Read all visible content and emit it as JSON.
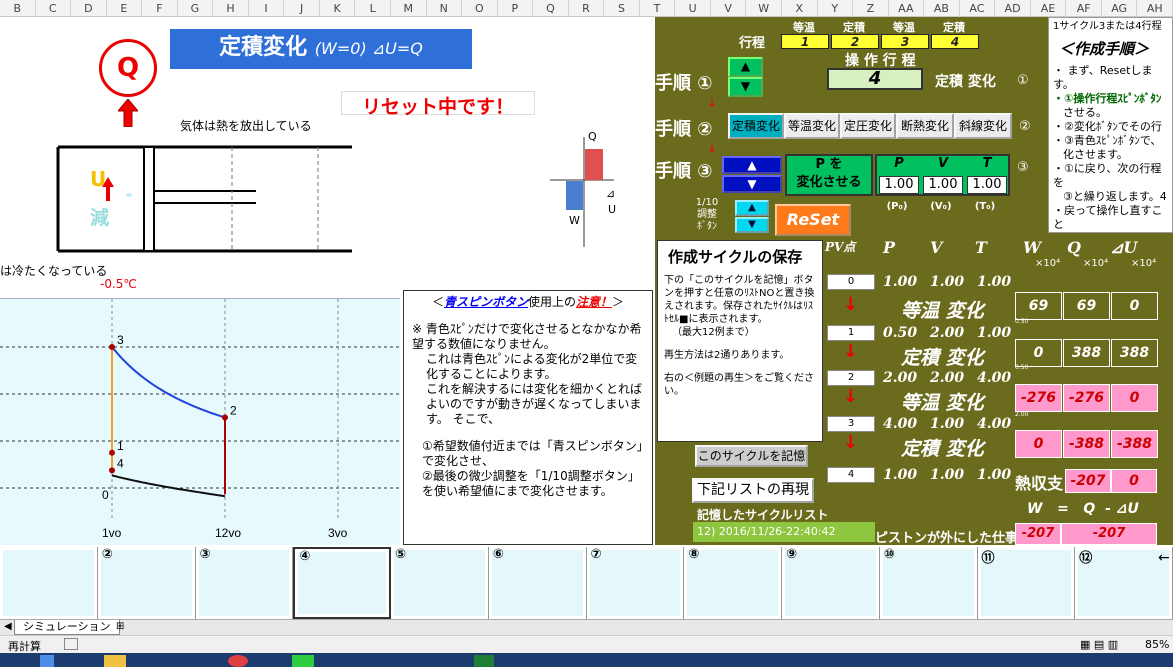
{
  "columns": [
    "B",
    "C",
    "D",
    "E",
    "F",
    "G",
    "H",
    "I",
    "J",
    "K",
    "L",
    "M",
    "N",
    "O",
    "P",
    "Q",
    "R",
    "S",
    "T",
    "U",
    "V",
    "W",
    "X",
    "Y",
    "Z",
    "AA",
    "AB",
    "AC",
    "AD",
    "AE",
    "AF",
    "AG",
    "AH"
  ],
  "left": {
    "q_symbol": "Q",
    "title_main": "定積変化",
    "title_sub": "(W=0)  ⊿U=Q",
    "reset_msg": "リセット中です！",
    "heat_msg": "気体は熱を放出している",
    "cool_msg": "は冷たくなっている",
    "temp": "-0.5℃",
    "u_label": "U",
    "gen_label": "減",
    "bar_q": "Q",
    "bar_w": "W",
    "bar_u": "U",
    "bar_du": "⊿"
  },
  "chart_data": {
    "type": "line",
    "title": "",
    "xlabel": "",
    "ylabel": "",
    "x_ticks": [
      "1vo",
      "12vo",
      "3vo"
    ],
    "y_tick": "0",
    "points": [
      {
        "label": "1",
        "v": 1,
        "p": 1
      },
      {
        "label": "2",
        "v": 2,
        "p": 2
      },
      {
        "label": "3",
        "v": 1,
        "p": 4
      },
      {
        "label": "4",
        "v": 1,
        "p": 0.5
      }
    ],
    "grid": true
  },
  "note": {
    "heading_pre": "＜",
    "heading_blue": "青スピンボタン",
    "heading_mid": "使用上の",
    "heading_red": "注意！",
    "heading_post": "＞",
    "line1": "※  青色ｽﾋﾟﾝだけで変化させるとなかなか希望する数値になりません。",
    "line2": "これは青色ｽﾋﾟﾝによる変化が2単位で変化することによります。",
    "line3": "これを解決するには変化を細かくとればよいのですが動きが遅くなってしまいます。   そこで、",
    "line4": "①希望数値付近までは「青スピンボタン」で変化させ、",
    "line5": "②最後の微少調整を「1/10調整ボタン」を使い希望値にまで変化させます。"
  },
  "save": {
    "title": "作成サイクルの保存",
    "body1": "下の「このサイクルを記憶」ボタンを押すと任意のﾘｽﾄNOと置き換えされます。保存されたｻｲｸﾙはﾘｽﾄｾﾙ■に表示されます。",
    "body2": "（最大12例まで）",
    "body3": "再生方法は2通りあります。",
    "body4": "右の＜例題の再生＞をご覧ください。",
    "memorize_btn": "このサイクルを記憶",
    "replay_btn": "下記リストの再現",
    "list_label": "記憶したサイクルリスト",
    "list_item": "12) 2016/11/26-22:40:42"
  },
  "right": {
    "process_label": "行程",
    "process_types": [
      "等温",
      "定積",
      "等温",
      "定積"
    ],
    "process_nums": [
      "1",
      "2",
      "3",
      "4"
    ],
    "sousa_label": "操 作 行 程",
    "sousa_value": "4",
    "step1": "手順 ①",
    "step2": "手順 ②",
    "step3": "手順 ③",
    "teiseki_henka": "定積 変化",
    "circle1": "①",
    "circle2": "②",
    "circle3": "③",
    "change_btns": [
      "定積変化",
      "等温変化",
      "定圧変化",
      "断熱変化",
      "斜線変化"
    ],
    "p_change_1": "P を",
    "p_change_2": "変化させる",
    "pvt_headers": [
      "P",
      "V",
      "T"
    ],
    "pvt_values": [
      "1.00",
      "1.00",
      "1.00"
    ],
    "pvt_subs": [
      "(P₀)",
      "(V₀)",
      "(T₀)"
    ],
    "adj_label": "1/10 調整 ﾎﾞﾀﾝ",
    "reset_btn": "ReSet",
    "table_headers": [
      "PV点",
      "P",
      "V",
      "T",
      "W",
      "Q",
      "⊿U"
    ],
    "unit": "×10⁴",
    "rows": [
      {
        "idx": "0",
        "p": "1.00",
        "v": "1.00",
        "t": "1.00"
      },
      {
        "idx": "1",
        "p": "0.50",
        "v": "2.00",
        "t": "1.00"
      },
      {
        "idx": "2",
        "p": "2.00",
        "v": "2.00",
        "t": "4.00"
      },
      {
        "idx": "3",
        "p": "4.00",
        "v": "1.00",
        "t": "4.00"
      },
      {
        "idx": "4",
        "p": "1.00",
        "v": "1.00",
        "t": "1.00"
      }
    ],
    "changes": [
      {
        "label": "等温 変化",
        "w": "69",
        "q": "69",
        "du": "0",
        "pink": false
      },
      {
        "label": "定積 変化",
        "w": "0",
        "q": "388",
        "du": "388",
        "pink": false
      },
      {
        "label": "等温 変化",
        "w": "-276",
        "q": "-276",
        "du": "0",
        "pink": true
      },
      {
        "label": "定積 変化",
        "w": "0",
        "q": "-388",
        "du": "-388",
        "pink": true
      }
    ],
    "heat_balance_label": "熱収支",
    "heat_balance_w": "-207",
    "heat_balance_q": "0",
    "formula": "W   =   Q  - ⊿U",
    "work_label": "ピストンが外にした仕事",
    "work_w": "-207",
    "work_total": "-207",
    "small_labels": [
      "0.50",
      "0.50",
      "2.00"
    ]
  },
  "procedure": {
    "top": "1サイクル3または4行程",
    "heading": "＜作成手順＞",
    "l1": "・ まず、Resetします。",
    "l2": "・①操作行程ｽﾋﾟﾝﾎﾞﾀﾝ",
    "l3": "させる。",
    "l4": "・②変化ﾎﾞﾀﾝでその行",
    "l5": "・③青色ｽﾋﾟﾝﾎﾞﾀﾝで、",
    "l6": "化させます。",
    "l7": "・①に戻り、次の行程を",
    "l8": "③と繰り返します。4",
    "l9": "・戻って操作し直すこと"
  },
  "thumbs": [
    "",
    "②",
    "③",
    "④",
    "⑤",
    "⑥",
    "⑦",
    "⑧",
    "⑨",
    "⑩",
    "⑪",
    "⑫"
  ],
  "tabs": {
    "sheet": "シミュレーション"
  },
  "status": {
    "left": "再計算",
    "zoom": "85%"
  }
}
